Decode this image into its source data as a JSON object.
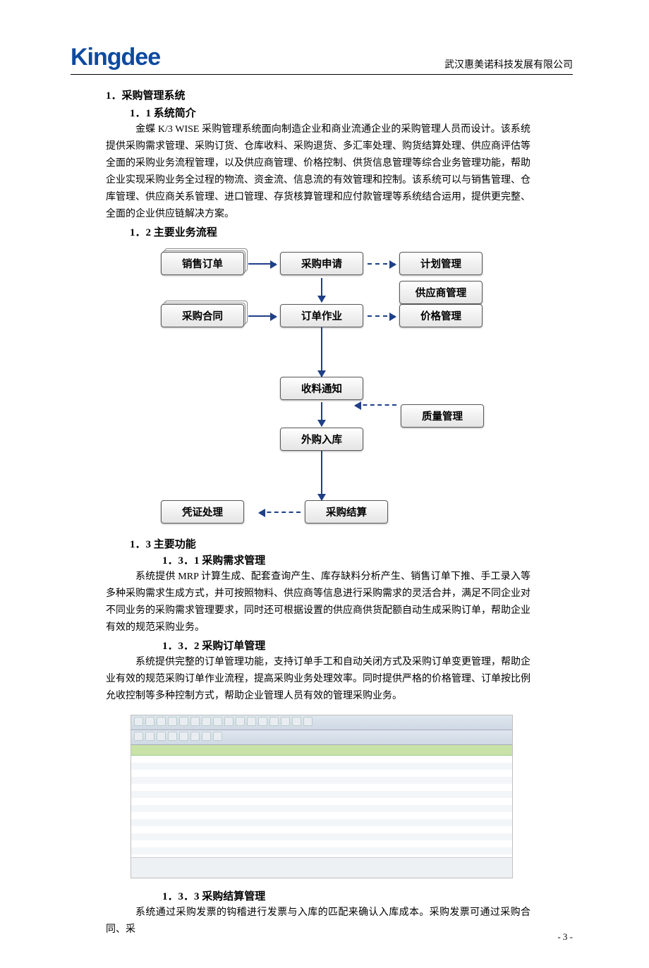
{
  "header": {
    "logo_text": "Kingdee",
    "company": "武汉惠美诺科技发展有限公司"
  },
  "section1_title": "1．采购管理系统",
  "s1_1_title": "1．1 系统简介",
  "s1_1_body": "金蝶 K/3 WISE 采购管理系统面向制造企业和商业流通企业的采购管理人员而设计。该系统提供采购需求管理、采购订货、仓库收料、采购退货、多汇率处理、购货结算处理、供应商评估等全面的采购业务流程管理，以及供应商管理、价格控制、供货信息管理等综合业务管理功能，帮助企业实现采购业务全过程的物流、资金流、信息流的有效管理和控制。该系统可以与销售管理、仓库管理、供应商关系管理、进口管理、存货核算管理和应付款管理等系统结合运用，提供更完整、全面的企业供应链解决方案。",
  "s1_2_title": "1．2 主要业务流程",
  "flow": {
    "sales_order": "销售订单",
    "purchase_request": "采购申请",
    "plan_mgmt": "计划管理",
    "supplier_mgmt": "供应商管理",
    "purchase_contract": "采购合同",
    "order_job": "订单作业",
    "price_mgmt": "价格管理",
    "receipt_notice": "收料通知",
    "quality_mgmt": "质量管理",
    "outsourced_in": "外购入库",
    "voucher": "凭证处理",
    "purchase_settle": "采购结算"
  },
  "s1_3_title": "1．3 主要功能",
  "s1_3_1_title": "1．3．1 采购需求管理",
  "s1_3_1_body": "系统提供 MRP 计算生成、配套查询产生、库存缺料分析产生、销售订单下推、手工录入等多种采购需求生成方式，并可按照物料、供应商等信息进行采购需求的灵活合并，满足不同企业对不同业务的采购需求管理要求，同时还可根据设置的供应商供货配额自动生成采购订单，帮助企业有效的规范采购业务。",
  "s1_3_2_title": "1．3．2 采购订单管理",
  "s1_3_2_body": "系统提供完整的订单管理功能，支持订单手工和自动关闭方式及采购订单变更管理，帮助企业有效的规范采购订单作业流程，提高采购业务处理效率。同时提供严格的价格管理、订单按比例允收控制等多种控制方式，帮助企业管理人员有效的管理采购业务。",
  "s1_3_3_title": "1．3．3 采购结算管理",
  "s1_3_3_body": "系统通过采购发票的钩稽进行发票与入库的匹配来确认入库成本。采购发票可通过采购合同、采",
  "page_number": "- 3 -"
}
